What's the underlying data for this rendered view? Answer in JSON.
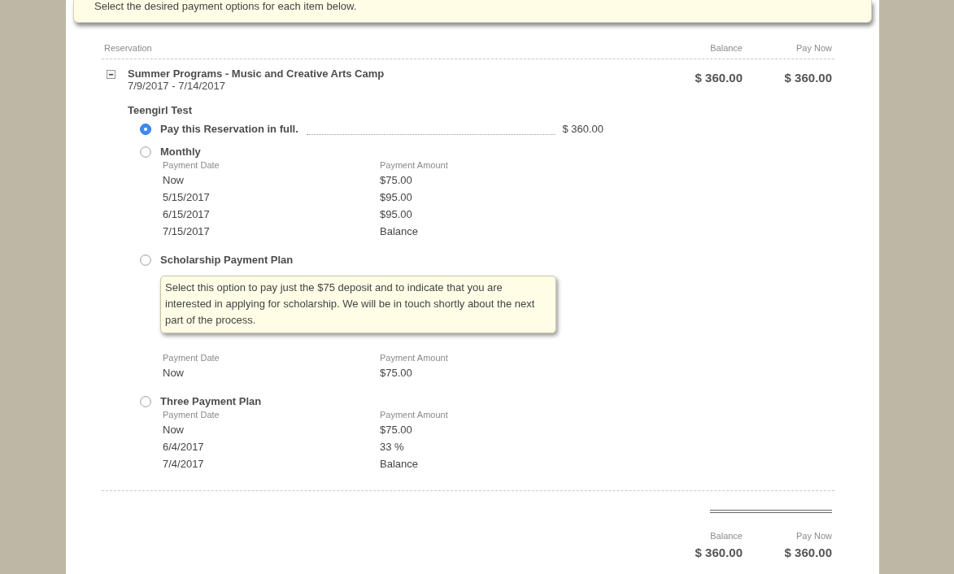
{
  "notice": {
    "text": "Select the desired payment options for each item below."
  },
  "table": {
    "columns": [
      "Reservation",
      "Balance",
      "Pay Now"
    ],
    "rows": [
      {
        "expanded": true,
        "title": "Summer Programs - Music and Creative Arts Camp",
        "dates": "7/9/2017 - 7/14/2017",
        "balance": "$ 360.00",
        "pay_now": "$ 360.00",
        "participant": "Teengirl Test",
        "options": [
          {
            "kind": "full",
            "label": "Pay this Reservation in full.",
            "selected": true,
            "amount": "$ 360.00"
          },
          {
            "kind": "plan",
            "label": "Monthly",
            "selected": false,
            "schedule": {
              "columns": [
                "Payment Date",
                "Payment Amount"
              ],
              "rows": [
                [
                  "Now",
                  "$75.00"
                ],
                [
                  "5/15/2017",
                  "$95.00"
                ],
                [
                  "6/15/2017",
                  "$95.00"
                ],
                [
                  "7/15/2017",
                  "Balance"
                ]
              ]
            }
          },
          {
            "kind": "plan",
            "label": "Scholarship Payment Plan",
            "selected": false,
            "note": "Select this option to pay just the $75 deposit and to indicate that you are interested in applying for scholarship. We will be in touch shortly about the next part of the process.",
            "schedule": {
              "columns": [
                "Payment Date",
                "Payment Amount"
              ],
              "rows": [
                [
                  "Now",
                  "$75.00"
                ]
              ]
            }
          },
          {
            "kind": "plan",
            "label": "Three Payment Plan",
            "selected": false,
            "schedule": {
              "columns": [
                "Payment Date",
                "Payment Amount"
              ],
              "rows": [
                [
                  "Now",
                  "$75.00"
                ],
                [
                  "6/4/2017",
                  "33 %"
                ],
                [
                  "7/4/2017",
                  "Balance"
                ]
              ]
            }
          }
        ]
      }
    ]
  },
  "totals": {
    "columns": [
      "Balance",
      "Pay Now"
    ],
    "values": [
      "$ 360.00",
      "$ 360.00"
    ]
  }
}
